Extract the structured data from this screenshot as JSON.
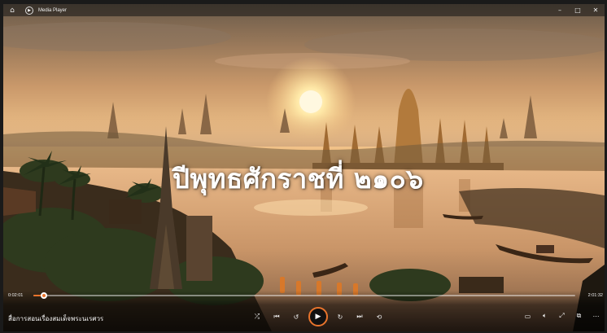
{
  "window": {
    "title": "Media Player",
    "controls": {
      "minimize": "–",
      "maximize": "□",
      "close": "✕"
    }
  },
  "video": {
    "caption": "ปีพุทธศักราชที่ ๒๑๐๖",
    "media_title": "สื่อการสอนเรื่องสมเด็จพระนเรศวร"
  },
  "playback": {
    "current_time": "0:02:01",
    "total_time": "2:01:32",
    "progress": 0.02
  },
  "icons": {
    "home": "home-icon",
    "app": "media-player-icon",
    "shuffle": "shuffle-icon",
    "previous": "previous-icon",
    "rewind": "rewind-10-icon",
    "play": "play-icon",
    "forward": "forward-30-icon",
    "next": "next-icon",
    "repeat": "repeat-off-icon",
    "subtitles": "subtitles-icon",
    "volume": "volume-icon",
    "fullscreen": "fullscreen-icon",
    "cast": "cast-icon",
    "more": "more-icon"
  },
  "colors": {
    "accent": "#e8742c"
  }
}
